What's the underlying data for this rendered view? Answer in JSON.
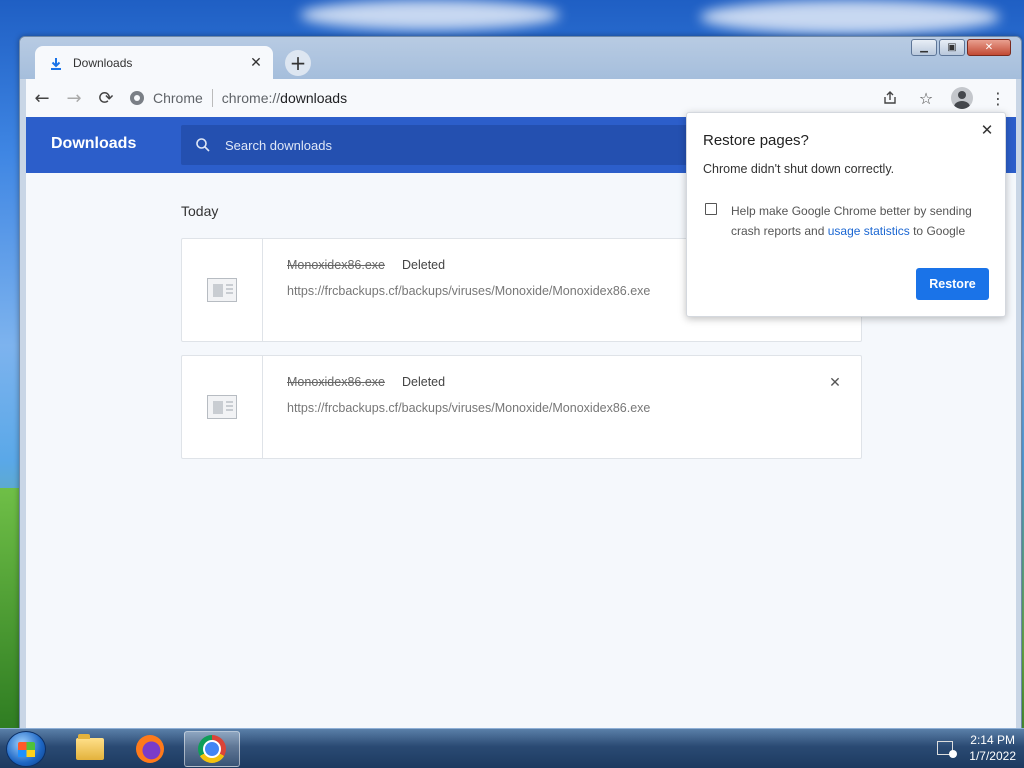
{
  "window": {
    "tab": {
      "title": "Downloads",
      "icon": "download-icon"
    },
    "new_tab_label": "+",
    "controls": {
      "minimize": "▁",
      "maximize": "▣",
      "close": "✕"
    }
  },
  "toolbar": {
    "back_icon": "←",
    "forward_icon": "→",
    "reload_icon": "⟳",
    "site_chip": "Chrome",
    "url_scheme": "chrome://",
    "url_path": "downloads",
    "share_icon": "share-icon",
    "bookmark_icon": "star-icon",
    "menu_icon": "⋮"
  },
  "downloads": {
    "header_title": "Downloads",
    "search_placeholder": "Search downloads",
    "section": "Today",
    "items": [
      {
        "filename": "Monoxidex86.exe",
        "status": "Deleted",
        "url": "https://frcbackups.cf/backups/viruses/Monoxide/Monoxidex86.exe"
      },
      {
        "filename": "Monoxidex86.exe",
        "status": "Deleted",
        "url": "https://frcbackups.cf/backups/viruses/Monoxide/Monoxidex86.exe"
      }
    ]
  },
  "restore_popup": {
    "title": "Restore pages?",
    "message": "Chrome didn't shut down correctly.",
    "checkbox_text_before": "Help make Google Chrome better by sending crash reports and ",
    "checkbox_link": "usage statistics",
    "checkbox_text_after": " to Google",
    "restore_button": "Restore"
  },
  "taskbar": {
    "clock_time": "2:14 PM",
    "clock_date": "1/7/2022",
    "apps": [
      "file-explorer",
      "firefox",
      "chrome"
    ]
  },
  "colors": {
    "header_blue": "#2c5eca",
    "button_blue": "#1a73e8",
    "link_blue": "#1a66d2"
  }
}
